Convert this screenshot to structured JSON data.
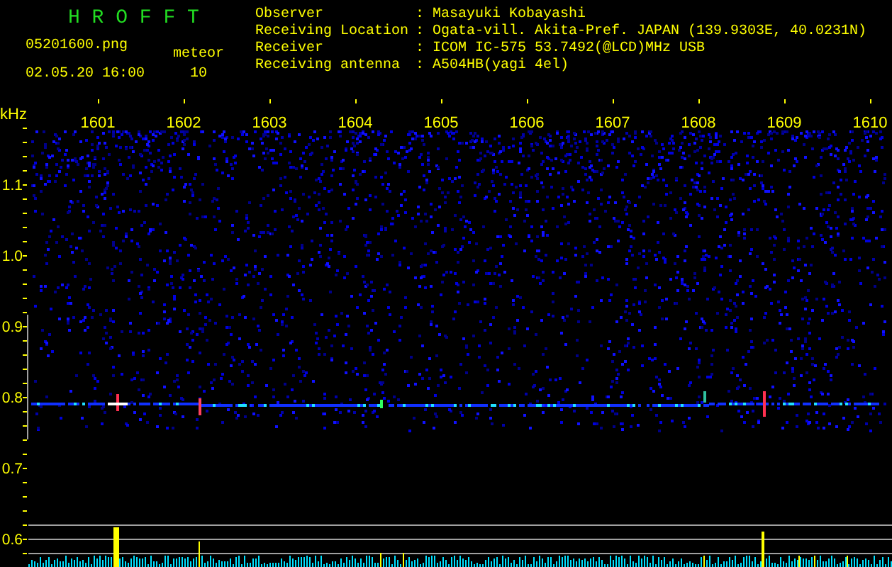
{
  "header": {
    "title": "H R O F F T",
    "filename": "05201600.png",
    "datetime": "02.05.20 16:00",
    "count_label": "meteor",
    "count": "10"
  },
  "station": [
    {
      "label": "Observer",
      "separator": ":",
      "value": "Masayuki Kobayashi"
    },
    {
      "label": "Receiving Location",
      "separator": ":",
      "value": "Ogata-vill. Akita-Pref. JAPAN (139.9303E, 40.0231N)"
    },
    {
      "label": "Receiver",
      "separator": ":",
      "value": "ICOM IC-575 53.7492(@LCD)MHz USB"
    },
    {
      "label": "Receiving antenna",
      "separator": ":",
      "value": "A504HB(yagi 4el)"
    }
  ],
  "plot": {
    "y_unit": "kHz",
    "y_labels": [
      "1.1",
      "1.0",
      "0.9",
      "0.8",
      "0.7",
      "0.6"
    ],
    "x_labels": [
      "1601",
      "1602",
      "1603",
      "1604",
      "1605",
      "1606",
      "1607",
      "1608",
      "1609",
      "1610"
    ]
  }
}
